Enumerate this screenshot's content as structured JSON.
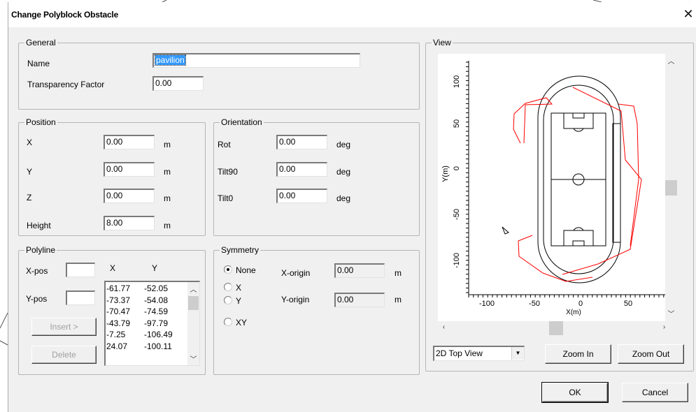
{
  "window": {
    "title": "Change Polyblock Obstacle",
    "close_glyph": "✕"
  },
  "general": {
    "legend": "General",
    "name_label": "Name",
    "name_value": "pavilion",
    "transparency_label": "Transparency Factor",
    "transparency_value": "0.00"
  },
  "position": {
    "legend": "Position",
    "x_label": "X",
    "x_value": "0.00",
    "x_unit": "m",
    "y_label": "Y",
    "y_value": "0.00",
    "y_unit": "m",
    "z_label": "Z",
    "z_value": "0.00",
    "z_unit": "m",
    "height_label": "Height",
    "height_value": "8.00",
    "height_unit": "m"
  },
  "orientation": {
    "legend": "Orientation",
    "rot_label": "Rot",
    "rot_value": "0.00",
    "rot_unit": "deg",
    "tilt90_label": "Tilt90",
    "tilt90_value": "0.00",
    "tilt90_unit": "deg",
    "tilt0_label": "Tilt0",
    "tilt0_value": "0.00",
    "tilt0_unit": "deg"
  },
  "polyline": {
    "legend": "Polyline",
    "xpos_label": "X-pos",
    "xpos_value": "",
    "ypos_label": "Y-pos",
    "ypos_value": "",
    "insert_label": "Insert >",
    "delete_label": "Delete",
    "col_x": "X",
    "col_y": "Y",
    "rows": [
      {
        "x": "-61.77",
        "y": "-52.05"
      },
      {
        "x": "-73.37",
        "y": "-54.08"
      },
      {
        "x": "-70.47",
        "y": "-74.59"
      },
      {
        "x": "-43.79",
        "y": "-97.79"
      },
      {
        "x": "-7.25",
        "y": "-106.49"
      },
      {
        "x": "24.07",
        "y": "-100.11"
      }
    ]
  },
  "symmetry": {
    "legend": "Symmetry",
    "options": [
      "None",
      "X",
      "Y",
      "XY"
    ],
    "selected": "None",
    "xorigin_label": "X-origin",
    "xorigin_value": "0.00",
    "xorigin_unit": "m",
    "yorigin_label": "Y-origin",
    "yorigin_value": "0.00",
    "yorigin_unit": "m"
  },
  "view": {
    "legend": "View",
    "mode": "2D Top View",
    "zoom_in_label": "Zoom In",
    "zoom_out_label": "Zoom Out",
    "plot": {
      "y_axis_label": "Y(m)",
      "x_axis_label": "X(m)",
      "y_ticks": [
        "100",
        "50",
        "0",
        "-50",
        "-100"
      ],
      "x_ticks": [
        "-100",
        "-50",
        "0",
        "50"
      ],
      "outline_color": "#000000",
      "polyline_color": "#ff0000"
    }
  },
  "buttons": {
    "ok_label": "OK",
    "cancel_label": "Cancel"
  }
}
